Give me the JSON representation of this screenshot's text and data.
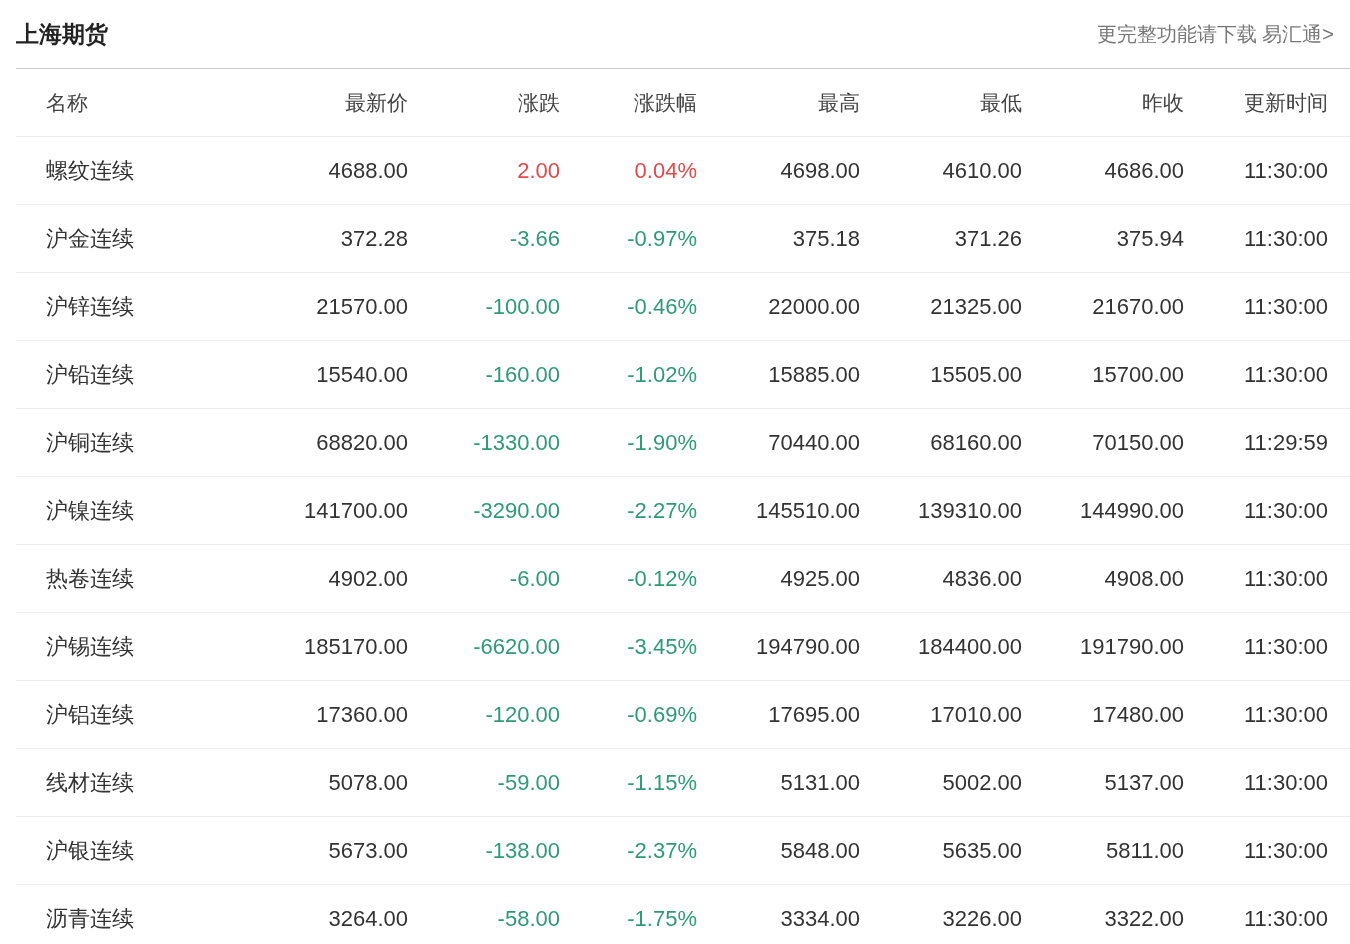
{
  "header": {
    "title": "上海期货",
    "link": "更完整功能请下载 易汇通>"
  },
  "table": {
    "columns": [
      "名称",
      "最新价",
      "涨跌",
      "涨跌幅",
      "最高",
      "最低",
      "昨收",
      "更新时间"
    ],
    "rows": [
      {
        "name": "螺纹连续",
        "last": "4688.00",
        "change": "2.00",
        "change_pct": "0.04%",
        "high": "4698.00",
        "low": "4610.00",
        "prev_close": "4686.00",
        "time": "11:30:00",
        "rising": true
      },
      {
        "name": "沪金连续",
        "last": "372.28",
        "change": "-3.66",
        "change_pct": "-0.97%",
        "high": "375.18",
        "low": "371.26",
        "prev_close": "375.94",
        "time": "11:30:00",
        "rising": false
      },
      {
        "name": "沪锌连续",
        "last": "21570.00",
        "change": "-100.00",
        "change_pct": "-0.46%",
        "high": "22000.00",
        "low": "21325.00",
        "prev_close": "21670.00",
        "time": "11:30:00",
        "rising": false
      },
      {
        "name": "沪铅连续",
        "last": "15540.00",
        "change": "-160.00",
        "change_pct": "-1.02%",
        "high": "15885.00",
        "low": "15505.00",
        "prev_close": "15700.00",
        "time": "11:30:00",
        "rising": false
      },
      {
        "name": "沪铜连续",
        "last": "68820.00",
        "change": "-1330.00",
        "change_pct": "-1.90%",
        "high": "70440.00",
        "low": "68160.00",
        "prev_close": "70150.00",
        "time": "11:29:59",
        "rising": false
      },
      {
        "name": "沪镍连续",
        "last": "141700.00",
        "change": "-3290.00",
        "change_pct": "-2.27%",
        "high": "145510.00",
        "low": "139310.00",
        "prev_close": "144990.00",
        "time": "11:30:00",
        "rising": false
      },
      {
        "name": "热卷连续",
        "last": "4902.00",
        "change": "-6.00",
        "change_pct": "-0.12%",
        "high": "4925.00",
        "low": "4836.00",
        "prev_close": "4908.00",
        "time": "11:30:00",
        "rising": false
      },
      {
        "name": "沪锡连续",
        "last": "185170.00",
        "change": "-6620.00",
        "change_pct": "-3.45%",
        "high": "194790.00",
        "low": "184400.00",
        "prev_close": "191790.00",
        "time": "11:30:00",
        "rising": false
      },
      {
        "name": "沪铝连续",
        "last": "17360.00",
        "change": "-120.00",
        "change_pct": "-0.69%",
        "high": "17695.00",
        "low": "17010.00",
        "prev_close": "17480.00",
        "time": "11:30:00",
        "rising": false
      },
      {
        "name": "线材连续",
        "last": "5078.00",
        "change": "-59.00",
        "change_pct": "-1.15%",
        "high": "5131.00",
        "low": "5002.00",
        "prev_close": "5137.00",
        "time": "11:30:00",
        "rising": false
      },
      {
        "name": "沪银连续",
        "last": "5673.00",
        "change": "-138.00",
        "change_pct": "-2.37%",
        "high": "5848.00",
        "low": "5635.00",
        "prev_close": "5811.00",
        "time": "11:30:00",
        "rising": false
      },
      {
        "name": "沥青连续",
        "last": "3264.00",
        "change": "-58.00",
        "change_pct": "-1.75%",
        "high": "3334.00",
        "low": "3226.00",
        "prev_close": "3322.00",
        "time": "11:30:00",
        "rising": false
      }
    ]
  }
}
